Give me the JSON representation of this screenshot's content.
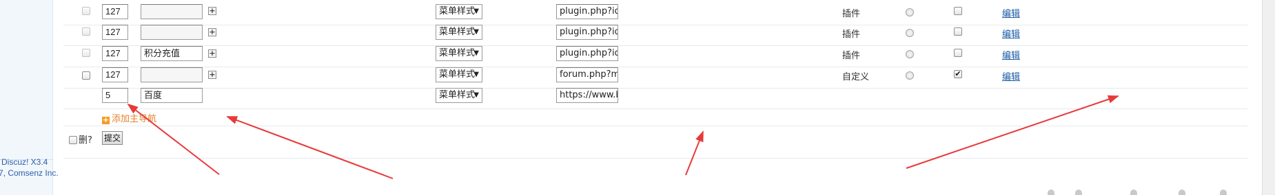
{
  "sidebar": {
    "footer": [
      "Discuz! X3.4",
      "7, Comsenz Inc."
    ]
  },
  "rows": [
    {
      "order": "127",
      "name": "",
      "style": "菜单样式",
      "url": "plugin.php?id=dz",
      "type": "插件",
      "checked": false,
      "edit": "编辑"
    },
    {
      "order": "127",
      "name": "",
      "style": "菜单样式",
      "url": "plugin.php?id=rjy",
      "type": "插件",
      "checked": false,
      "edit": "编辑"
    },
    {
      "order": "127",
      "name": "积分充值",
      "style": "菜单样式",
      "url": "plugin.php?id=th",
      "type": "插件",
      "checked": false,
      "edit": "编辑"
    },
    {
      "order": "127",
      "name": "",
      "style": "菜单样式",
      "url": "forum.php?mod=",
      "type": "自定义",
      "checked": true,
      "edit": "编辑"
    }
  ],
  "new_row": {
    "order": "5",
    "name": "百度",
    "style": "菜单样式",
    "url": "https://www.baid"
  },
  "add_label": "添加主导航",
  "delete_label": "删?",
  "submit_label": "提交",
  "annotation_color": "#e8393a"
}
